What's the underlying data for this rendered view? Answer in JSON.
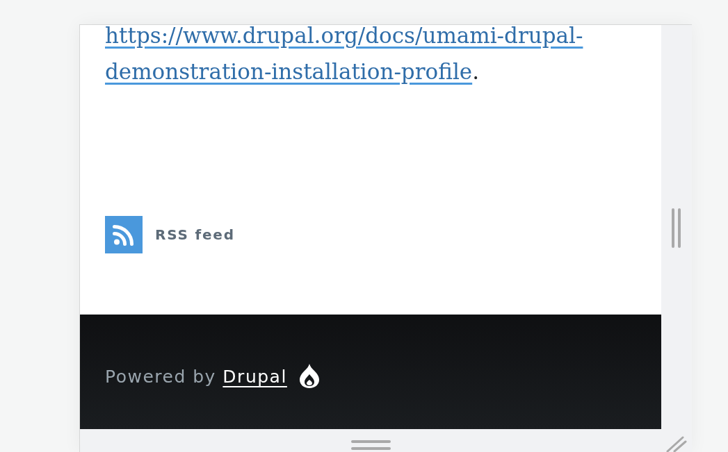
{
  "article": {
    "link_lines": [
      "https://www.drupal.org/docs/umami-drupal-",
      "demonstration-installation-profile"
    ],
    "trailing_text": "."
  },
  "feed_link": {
    "label": "RSS feed"
  },
  "footer": {
    "prefix": "Powered by",
    "link": "Drupal"
  }
}
